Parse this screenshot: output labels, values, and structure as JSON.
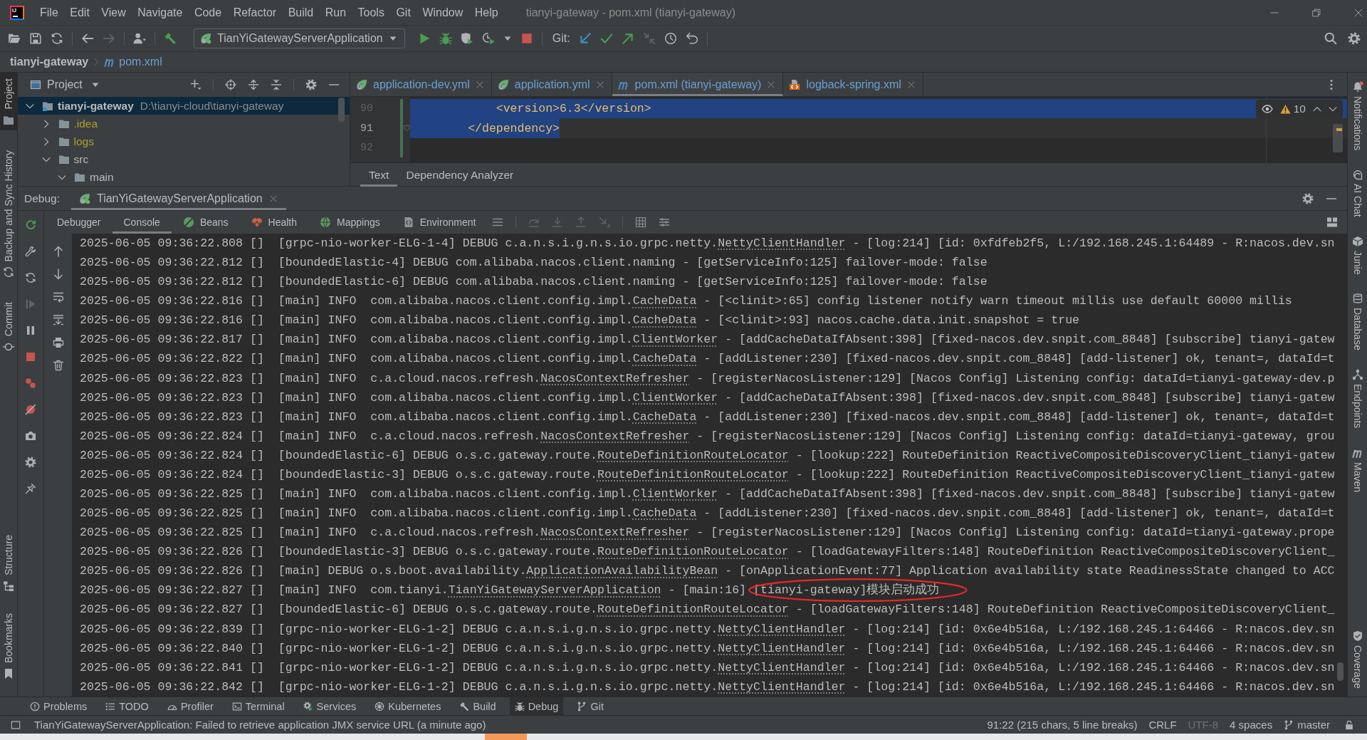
{
  "title_bar": {
    "logo": "IJ",
    "menu": [
      "File",
      "Edit",
      "View",
      "Navigate",
      "Code",
      "Refactor",
      "Build",
      "Run",
      "Tools",
      "Git",
      "Window",
      "Help"
    ],
    "title": "tianyi-gateway - pom.xml (tianyi-gateway)"
  },
  "toolbar": {
    "run_configuration": "TianYiGatewayServerApplication",
    "vcs_label": "Git:"
  },
  "breadcrumbs": [
    {
      "label": "tianyi-gateway",
      "kind": "project",
      "modified": false
    },
    {
      "label": "pom.xml",
      "kind": "maven_file",
      "modified": true
    }
  ],
  "left_stripe": {
    "top": [
      {
        "label": "Project",
        "kind": "project",
        "selected": true
      },
      {
        "label": "Backup and Sync History",
        "kind": "backup",
        "selected": false
      },
      {
        "label": "Commit",
        "kind": "commit",
        "selected": false
      }
    ],
    "bottom": [
      {
        "label": "Structure",
        "kind": "structure",
        "selected": false
      },
      {
        "label": "Bookmarks",
        "kind": "bookmarks",
        "selected": false
      }
    ]
  },
  "project_panel": {
    "title": "Project",
    "tree": [
      {
        "name": "tianyi-gateway",
        "path": "D:\\tianyi-cloud\\tianyi-gateway",
        "kind": "module",
        "expanded": true,
        "selected": true,
        "ignored": false,
        "children": [
          {
            "name": ".idea",
            "kind": "folder",
            "expanded": false,
            "selected": false,
            "ignored": true
          },
          {
            "name": "logs",
            "kind": "folder",
            "expanded": false,
            "selected": false,
            "ignored": true
          },
          {
            "name": "src",
            "kind": "folder",
            "expanded": true,
            "selected": false,
            "ignored": false,
            "children": [
              {
                "name": "main",
                "kind": "folder",
                "expanded": true,
                "selected": false,
                "ignored": false
              }
            ]
          }
        ]
      }
    ]
  },
  "editor": {
    "tabs": [
      {
        "label": "application-dev.yml",
        "kind": "spring",
        "modified": true,
        "selected": false
      },
      {
        "label": "application.yml",
        "kind": "spring",
        "modified": true,
        "selected": false
      },
      {
        "label": "pom.xml (tianyi-gateway)",
        "kind": "maven",
        "modified": true,
        "selected": true
      },
      {
        "label": "logback-spring.xml",
        "kind": "xml",
        "modified": true,
        "selected": false
      }
    ],
    "lines": [
      {
        "number": "90",
        "code": "            <version>6.3</version>",
        "selected": true,
        "current": false,
        "changed": true,
        "foldable": false
      },
      {
        "number": "91",
        "code": "        </dependency>",
        "selected": true,
        "current": true,
        "changed": true,
        "foldable": true
      },
      {
        "number": "92",
        "selected": false,
        "current": false,
        "changed": true,
        "foldable": false
      }
    ],
    "inspections": {
      "warnings": "10"
    },
    "bottom_tabs": [
      {
        "label": "Text",
        "selected": true
      },
      {
        "label": "Dependency Analyzer",
        "selected": false
      }
    ]
  },
  "debug": {
    "label": "Debug:",
    "sessions": [
      {
        "label": "TianYiGatewayServerApplication",
        "selected": true
      }
    ],
    "tabs": [
      {
        "label": "Debugger",
        "kind": "plain",
        "selected": false
      },
      {
        "label": "Console",
        "kind": "plain",
        "selected": true
      },
      {
        "label": "Beans",
        "kind": "beans",
        "selected": false
      },
      {
        "label": "Health",
        "kind": "health",
        "selected": false
      },
      {
        "label": "Mappings",
        "kind": "mappings",
        "selected": false
      },
      {
        "label": "Environment",
        "kind": "environment",
        "selected": false
      }
    ],
    "console": [
      {
        "pre": "2025-06-05 09:36:22.808 []  [grpc-nio-worker-ELG-1-4] DEBUG c.a.n.s.i.g.n.s.io.grpc.netty.",
        "link": "NettyClientHandler",
        "post": " - [log:214] [id: 0xfdfeb2f5, L:/192.168.245.1:64489 - R:nacos.dev.sn",
        "circled": false
      },
      {
        "pre": "2025-06-05 09:36:22.812 []  [boundedElastic-4] DEBUG com.alibaba.nacos.client.naming - [getServiceInfo:125] failover-mode: false",
        "circled": false
      },
      {
        "pre": "2025-06-05 09:36:22.812 []  [boundedElastic-6] DEBUG com.alibaba.nacos.client.naming - [getServiceInfo:125] failover-mode: false",
        "circled": false
      },
      {
        "pre": "2025-06-05 09:36:22.816 []  [main] INFO  com.alibaba.nacos.client.config.impl.",
        "link": "CacheData",
        "post": " - [<clinit>:65] config listener notify warn timeout millis use default 60000 millis",
        "circled": false
      },
      {
        "pre": "2025-06-05 09:36:22.816 []  [main] INFO  com.alibaba.nacos.client.config.impl.",
        "link": "CacheData",
        "post": " - [<clinit>:93] nacos.cache.data.init.snapshot = true",
        "circled": false
      },
      {
        "pre": "2025-06-05 09:36:22.817 []  [main] INFO  com.alibaba.nacos.client.config.impl.",
        "link": "ClientWorker",
        "post": " - [addCacheDataIfAbsent:398] [fixed-nacos.dev.snpit.com_8848] [subscribe] tianyi-gatew",
        "circled": false
      },
      {
        "pre": "2025-06-05 09:36:22.822 []  [main] INFO  com.alibaba.nacos.client.config.impl.",
        "link": "CacheData",
        "post": " - [addListener:230] [fixed-nacos.dev.snpit.com_8848] [add-listener] ok, tenant=, dataId=t",
        "circled": false
      },
      {
        "pre": "2025-06-05 09:36:22.823 []  [main] INFO  c.a.cloud.nacos.refresh.",
        "link": "NacosContextRefresher",
        "post": " - [registerNacosListener:129] [Nacos Config] Listening config: dataId=tianyi-gateway-dev.p",
        "circled": false
      },
      {
        "pre": "2025-06-05 09:36:22.823 []  [main] INFO  com.alibaba.nacos.client.config.impl.",
        "link": "ClientWorker",
        "post": " - [addCacheDataIfAbsent:398] [fixed-nacos.dev.snpit.com_8848] [subscribe] tianyi-gatew",
        "circled": false
      },
      {
        "pre": "2025-06-05 09:36:22.823 []  [main] INFO  com.alibaba.nacos.client.config.impl.",
        "link": "CacheData",
        "post": " - [addListener:230] [fixed-nacos.dev.snpit.com_8848] [add-listener] ok, tenant=, dataId=t",
        "circled": false
      },
      {
        "pre": "2025-06-05 09:36:22.824 []  [main] INFO  c.a.cloud.nacos.refresh.",
        "link": "NacosContextRefresher",
        "post": " - [registerNacosListener:129] [Nacos Config] Listening config: dataId=tianyi-gateway, grou",
        "circled": false
      },
      {
        "pre": "2025-06-05 09:36:22.824 []  [boundedElastic-6] DEBUG o.s.c.gateway.route.",
        "link": "RouteDefinitionRouteLocator",
        "post": " - [lookup:222] RouteDefinition ReactiveCompositeDiscoveryClient_tianyi-gatew",
        "circled": false
      },
      {
        "pre": "2025-06-05 09:36:22.824 []  [boundedElastic-3] DEBUG o.s.c.gateway.route.",
        "link": "RouteDefinitionRouteLocator",
        "post": " - [lookup:222] RouteDefinition ReactiveCompositeDiscoveryClient_tianyi-gatew",
        "circled": false
      },
      {
        "pre": "2025-06-05 09:36:22.825 []  [main] INFO  com.alibaba.nacos.client.config.impl.",
        "link": "ClientWorker",
        "post": " - [addCacheDataIfAbsent:398] [fixed-nacos.dev.snpit.com_8848] [subscribe] tianyi-gatew",
        "circled": false
      },
      {
        "pre": "2025-06-05 09:36:22.825 []  [main] INFO  com.alibaba.nacos.client.config.impl.",
        "link": "CacheData",
        "post": " - [addListener:230] [fixed-nacos.dev.snpit.com_8848] [add-listener] ok, tenant=, dataId=t",
        "circled": false
      },
      {
        "pre": "2025-06-05 09:36:22.825 []  [main] INFO  c.a.cloud.nacos.refresh.",
        "link": "NacosContextRefresher",
        "post": " - [registerNacosListener:129] [Nacos Config] Listening config: dataId=tianyi-gateway.prope",
        "circled": false
      },
      {
        "pre": "2025-06-05 09:36:22.826 []  [boundedElastic-3] DEBUG o.s.c.gateway.route.",
        "link": "RouteDefinitionRouteLocator",
        "post": " - [loadGatewayFilters:148] RouteDefinition ReactiveCompositeDiscoveryClient_",
        "circled": false
      },
      {
        "pre": "2025-06-05 09:36:22.826 []  [main] DEBUG o.s.boot.availability.",
        "link": "ApplicationAvailabilityBean",
        "post": " - [onApplicationEvent:77] Application availability state ReadinessState changed to ACC",
        "circled": false
      },
      {
        "pre": "2025-06-05 09:36:22.827 []  [main] INFO  com.tianyi.",
        "link": "TianYiGatewayServerApplication",
        "post": " - [main:16] [tianyi-gateway]模块启动成功",
        "circled": true
      },
      {
        "pre": "2025-06-05 09:36:22.827 []  [boundedElastic-6] DEBUG o.s.c.gateway.route.",
        "link": "RouteDefinitionRouteLocator",
        "post": " - [loadGatewayFilters:148] RouteDefinition ReactiveCompositeDiscoveryClient_",
        "circled": false
      },
      {
        "pre": "2025-06-05 09:36:22.839 []  [grpc-nio-worker-ELG-1-2] DEBUG c.a.n.s.i.g.n.s.io.grpc.netty.",
        "link": "NettyClientHandler",
        "post": " - [log:214] [id: 0x6e4b516a, L:/192.168.245.1:64466 - R:nacos.dev.sn",
        "circled": false
      },
      {
        "pre": "2025-06-05 09:36:22.840 []  [grpc-nio-worker-ELG-1-2] DEBUG c.a.n.s.i.g.n.s.io.grpc.netty.",
        "link": "NettyClientHandler",
        "post": " - [log:214] [id: 0x6e4b516a, L:/192.168.245.1:64466 - R:nacos.dev.sn",
        "circled": false
      },
      {
        "pre": "2025-06-05 09:36:22.841 []  [grpc-nio-worker-ELG-1-2] DEBUG c.a.n.s.i.g.n.s.io.grpc.netty.",
        "link": "NettyClientHandler",
        "post": " - [log:214] [id: 0x6e4b516a, L:/192.168.245.1:64466 - R:nacos.dev.sn",
        "circled": false
      },
      {
        "pre": "2025-06-05 09:36:22.842 []  [grpc-nio-worker-ELG-1-2] DEBUG c.a.n.s.i.g.n.s.io.grpc.netty.",
        "link": "NettyClientHandler",
        "post": " - [log:214] [id: 0x6e4b516a, L:/192.168.245.1:64466 - R:nacos.dev.sn",
        "circled": false
      }
    ]
  },
  "right_stripe": {
    "top": [
      {
        "label": "Notifications",
        "kind": "notifications"
      },
      {
        "label": "AI Chat",
        "kind": "ai_chat"
      },
      {
        "label": "Junie",
        "kind": "junie"
      },
      {
        "label": "Database",
        "kind": "database"
      },
      {
        "label": "Endpoints",
        "kind": "endpoints"
      },
      {
        "label": "Maven",
        "kind": "maven"
      }
    ],
    "bottom": [
      {
        "label": "Coverage",
        "kind": "coverage"
      }
    ]
  },
  "bottom_bar": [
    {
      "label": "Problems",
      "kind": "problems",
      "selected": false
    },
    {
      "label": "TODO",
      "kind": "todo",
      "selected": false
    },
    {
      "label": "Profiler",
      "kind": "profiler",
      "selected": false
    },
    {
      "label": "Terminal",
      "kind": "terminal",
      "selected": false
    },
    {
      "label": "Services",
      "kind": "services",
      "selected": false
    },
    {
      "label": "Kubernetes",
      "kind": "kubernetes",
      "selected": false
    },
    {
      "label": "Build",
      "kind": "build",
      "selected": false
    },
    {
      "label": "Debug",
      "kind": "debug",
      "selected": true
    },
    {
      "label": "Git",
      "kind": "git",
      "selected": false
    }
  ],
  "status_bar": {
    "message": "TianYiGatewayServerApplication: Failed to retrieve application JMX service URL (a minute ago)",
    "widgets": [
      {
        "label": "91:22 (215 chars, 5 line breaks)",
        "kind": "text",
        "disabled": false
      },
      {
        "label": "CRLF",
        "kind": "text",
        "disabled": false
      },
      {
        "label": "UTF-8",
        "kind": "text",
        "disabled": true
      },
      {
        "label": "4 spaces",
        "kind": "text",
        "disabled": false
      },
      {
        "label": "master",
        "kind": "branch",
        "disabled": false
      }
    ]
  }
}
